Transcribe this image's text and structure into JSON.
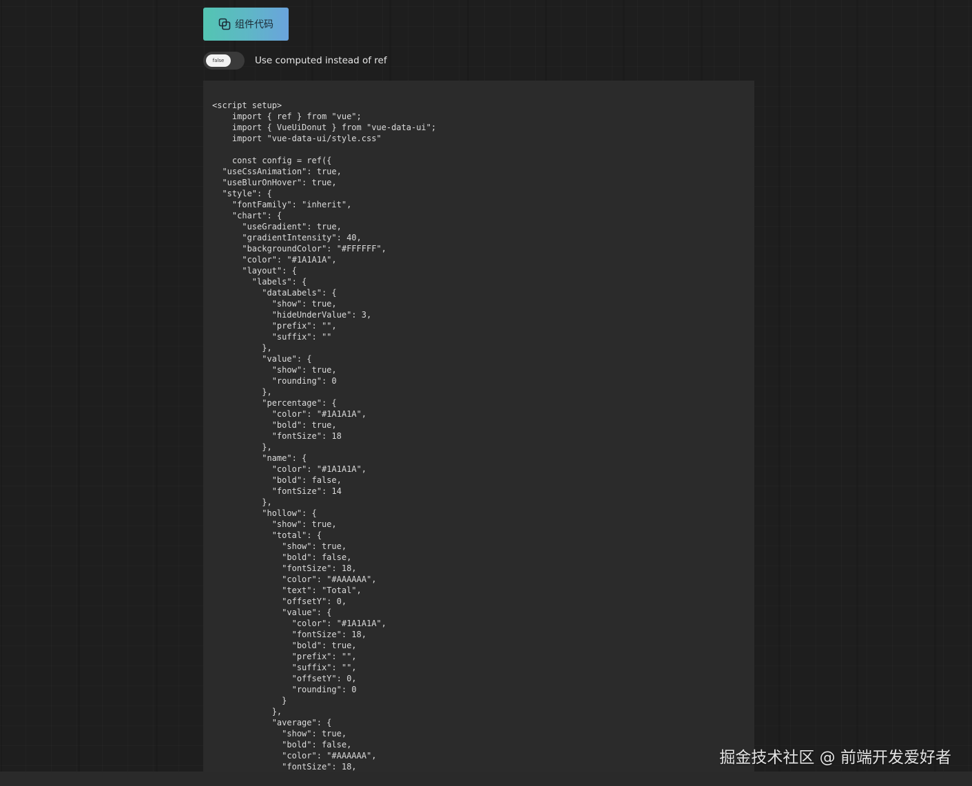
{
  "copy_button": {
    "label": "组件代码",
    "icon": "copy-icon"
  },
  "toggle": {
    "state_text": "false",
    "label": "Use computed instead of ref"
  },
  "code": {
    "text": "<script setup>\n    import { ref } from \"vue\";\n    import { VueUiDonut } from \"vue-data-ui\";\n    import \"vue-data-ui/style.css\"\n\n    const config = ref({\n  \"useCssAnimation\": true,\n  \"useBlurOnHover\": true,\n  \"style\": {\n    \"fontFamily\": \"inherit\",\n    \"chart\": {\n      \"useGradient\": true,\n      \"gradientIntensity\": 40,\n      \"backgroundColor\": \"#FFFFFF\",\n      \"color\": \"#1A1A1A\",\n      \"layout\": {\n        \"labels\": {\n          \"dataLabels\": {\n            \"show\": true,\n            \"hideUnderValue\": 3,\n            \"prefix\": \"\",\n            \"suffix\": \"\"\n          },\n          \"value\": {\n            \"show\": true,\n            \"rounding\": 0\n          },\n          \"percentage\": {\n            \"color\": \"#1A1A1A\",\n            \"bold\": true,\n            \"fontSize\": 18\n          },\n          \"name\": {\n            \"color\": \"#1A1A1A\",\n            \"bold\": false,\n            \"fontSize\": 14\n          },\n          \"hollow\": {\n            \"show\": true,\n            \"total\": {\n              \"show\": true,\n              \"bold\": false,\n              \"fontSize\": 18,\n              \"color\": \"#AAAAAA\",\n              \"text\": \"Total\",\n              \"offsetY\": 0,\n              \"value\": {\n                \"color\": \"#1A1A1A\",\n                \"fontSize\": 18,\n                \"bold\": true,\n                \"prefix\": \"\",\n                \"suffix\": \"\",\n                \"offsetY\": 0,\n                \"rounding\": 0\n              }\n            },\n            \"average\": {\n              \"show\": true,\n              \"bold\": false,\n              \"color\": \"#AAAAAA\",\n              \"fontSize\": 18,"
  },
  "watermark": {
    "text": "掘金技术社区 @ 前端开发爱好者"
  },
  "colors": {
    "button_gradient_start": "#53c5b2",
    "button_gradient_end": "#6aa3dd",
    "page_background": "#1e1e1e",
    "code_background": "#2b2b2b"
  }
}
